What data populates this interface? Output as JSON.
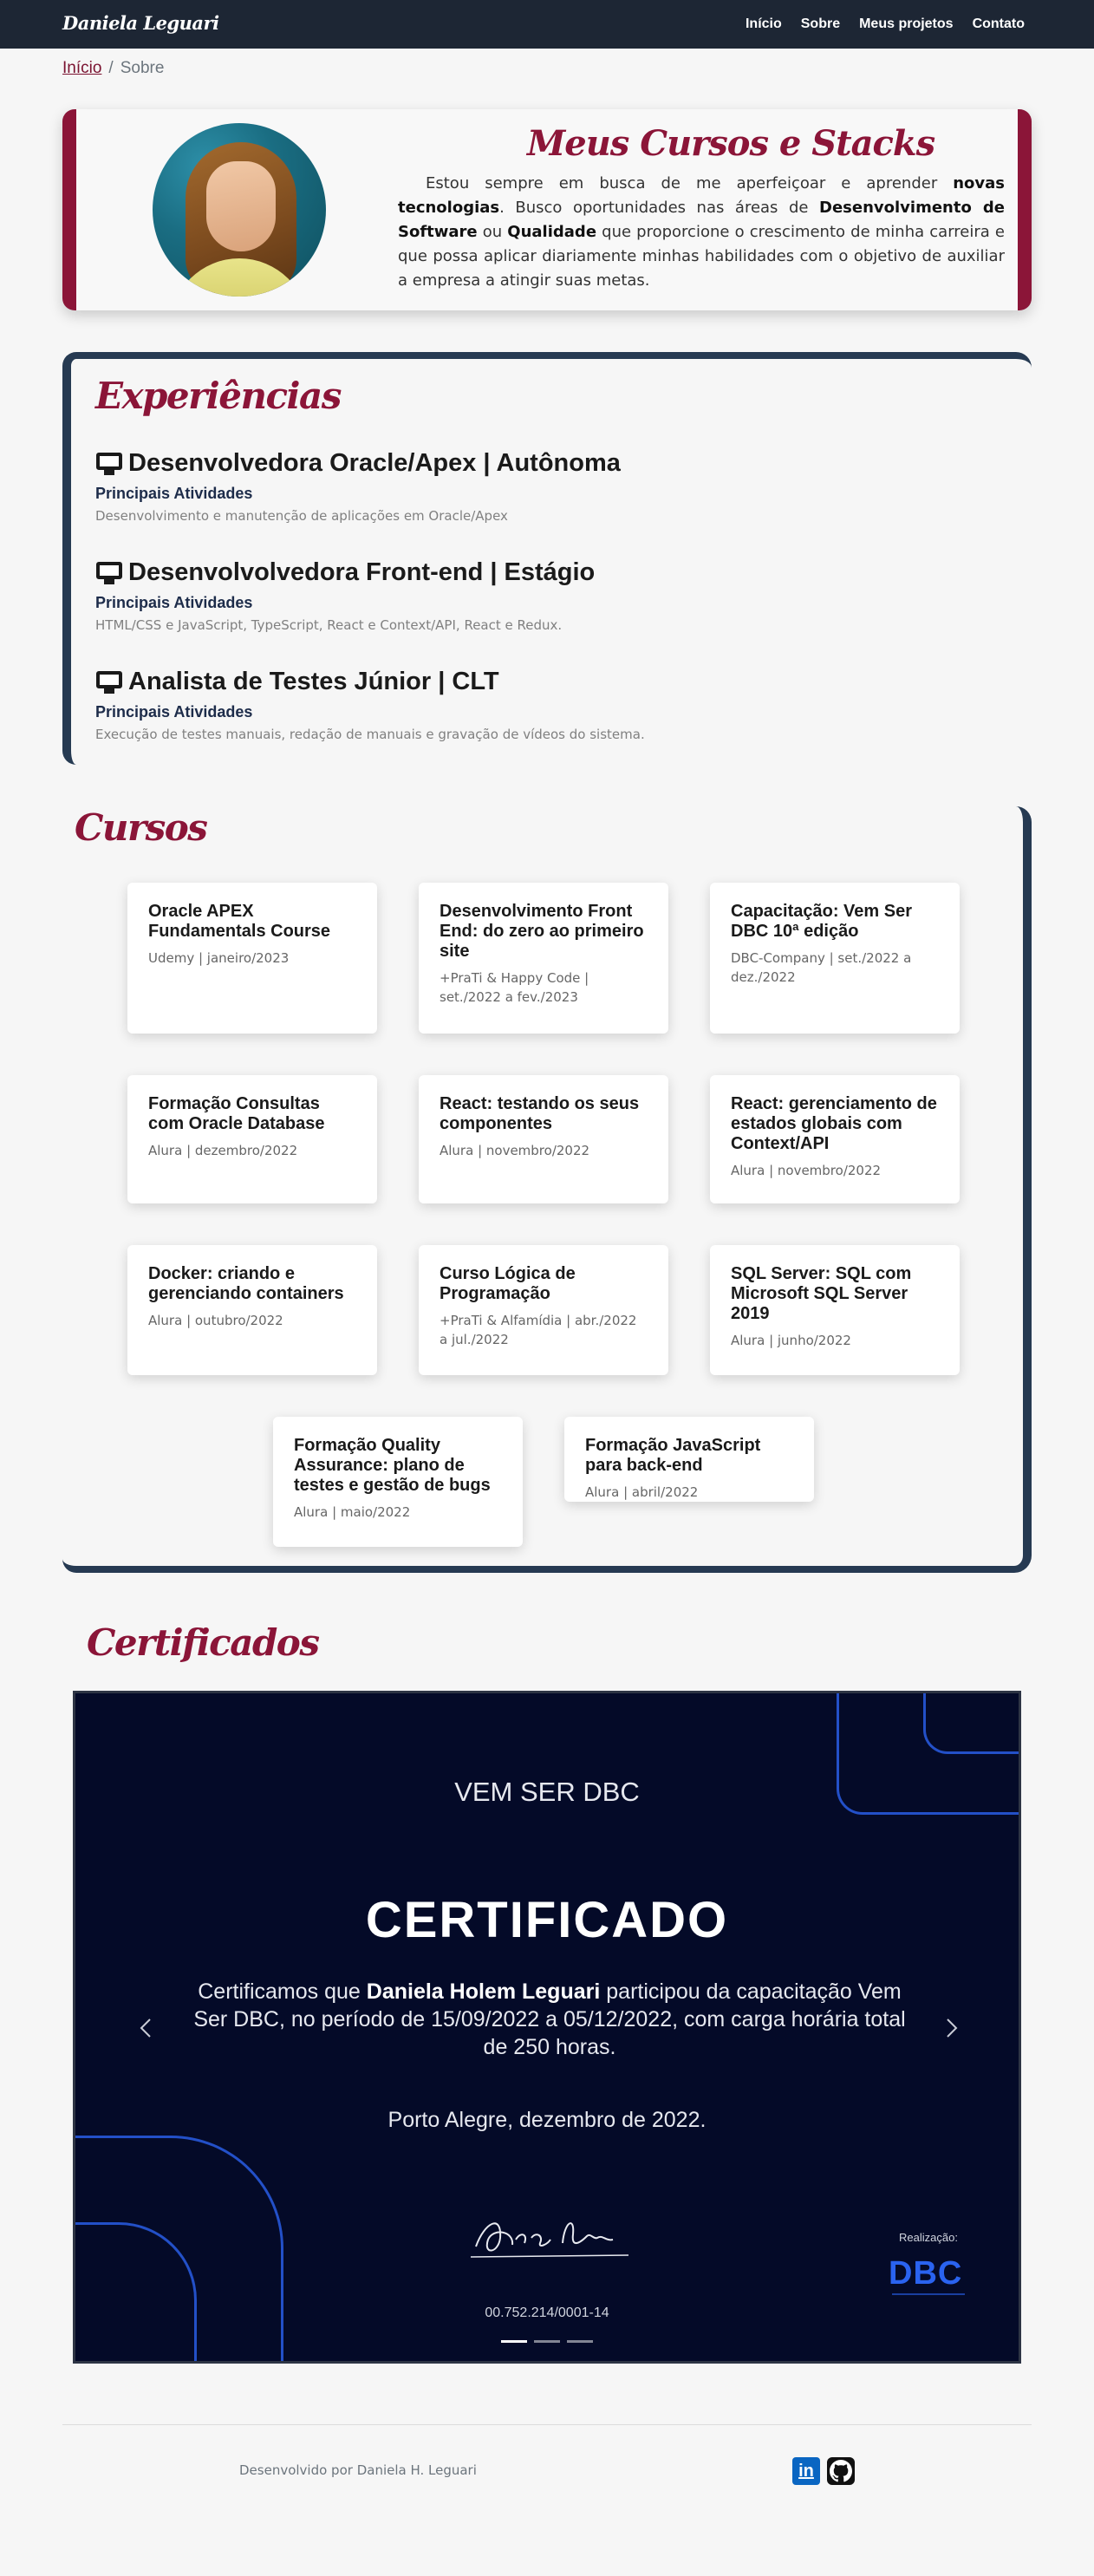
{
  "navbar": {
    "brand": "Daniela Leguari",
    "links": [
      "Início",
      "Sobre",
      "Meus projetos",
      "Contato"
    ]
  },
  "breadcrumb": {
    "home": "Início",
    "separator": "/",
    "current": "Sobre"
  },
  "about": {
    "title": "Meus Cursos e Stacks",
    "text_parts": [
      "Estou sempre em busca de me aperfeiçoar e aprender ",
      "novas tecnologias",
      ". Busco oportunidades nas áreas de ",
      "Desenvolvimento de Software",
      " ou ",
      "Qualidade",
      " que proporcione o crescimento de minha carreira e que possa aplicar diariamente minhas habilidades com o objetivo de auxiliar a empresa a atingir suas metas."
    ]
  },
  "experiences": {
    "title": "Experiências",
    "items": [
      {
        "title": "Desenvolvedora Oracle/Apex | Autônoma",
        "subtitle": "Principais Atividades",
        "description": "Desenvolvimento e manutenção de aplicações em Oracle/Apex"
      },
      {
        "title": "Desenvolvolvedora Front-end | Estágio",
        "subtitle": "Principais Atividades",
        "description": "HTML/CSS e JavaScript, TypeScript, React e Context/API, React e Redux."
      },
      {
        "title": "Analista de Testes Júnior | CLT",
        "subtitle": "Principais Atividades",
        "description": "Execução de testes manuais, redação de manuais e gravação de vídeos do sistema."
      }
    ]
  },
  "courses": {
    "title": "Cursos",
    "items": [
      {
        "title": "Oracle APEX Fundamentals Course",
        "meta": "Udemy | janeiro/2023"
      },
      {
        "title": "Desenvolvimento Front End: do zero ao primeiro site",
        "meta": "+PraTi & Happy Code | set./2022 a fev./2023"
      },
      {
        "title": "Capacitação: Vem Ser DBC 10ª edição",
        "meta": "DBC-Company | set./2022 a dez./2022"
      },
      {
        "title": "Formação Consultas com Oracle Database",
        "meta": "Alura | dezembro/2022"
      },
      {
        "title": "React: testando os seus componentes",
        "meta": "Alura | novembro/2022"
      },
      {
        "title": "React: gerenciamento de estados globais com Context/API",
        "meta": "Alura | novembro/2022"
      },
      {
        "title": "Docker: criando e gerenciando containers",
        "meta": "Alura | outubro/2022"
      },
      {
        "title": "Curso Lógica de Programação",
        "meta": "+PraTi & Alfamídia | abr./2022 a jul./2022"
      },
      {
        "title": "SQL Server: SQL com Microsoft SQL Server 2019",
        "meta": "Alura | junho/2022"
      },
      {
        "title": "Formação Quality Assurance: plano de testes e gestão de bugs",
        "meta": "Alura | maio/2022"
      },
      {
        "title": "Formação JavaScript para back-end",
        "meta": "Alura | abril/2022"
      }
    ]
  },
  "certificates": {
    "title": "Certificados",
    "slide": {
      "header": "VEM SER DBC",
      "heading": "CERTIFICADO",
      "body_prefix": "Certificamos que ",
      "body_name": "Daniela Holem Leguari",
      "body_suffix": " participou da capacitação Vem Ser DBC, no período de 15/09/2022 a 05/12/2022, com carga horária total de 250 horas.",
      "place_date": "Porto Alegre, dezembro de 2022.",
      "cnpj": "00.752.214/0001-14",
      "realizacao": "Realização:",
      "logo": "DBC"
    },
    "indicator_count": 3,
    "active_indicator": 1
  },
  "footer": {
    "text": "Desenvolvido por Daniela H. Leguari",
    "social": [
      "linkedin-icon",
      "github-icon"
    ]
  },
  "colors": {
    "navbar": "#1d2634",
    "accent": "#8b1538",
    "frame": "#263a52",
    "background": "#f6f6f6",
    "certificate_bg": "#040a28",
    "certificate_line": "#2350c8"
  }
}
